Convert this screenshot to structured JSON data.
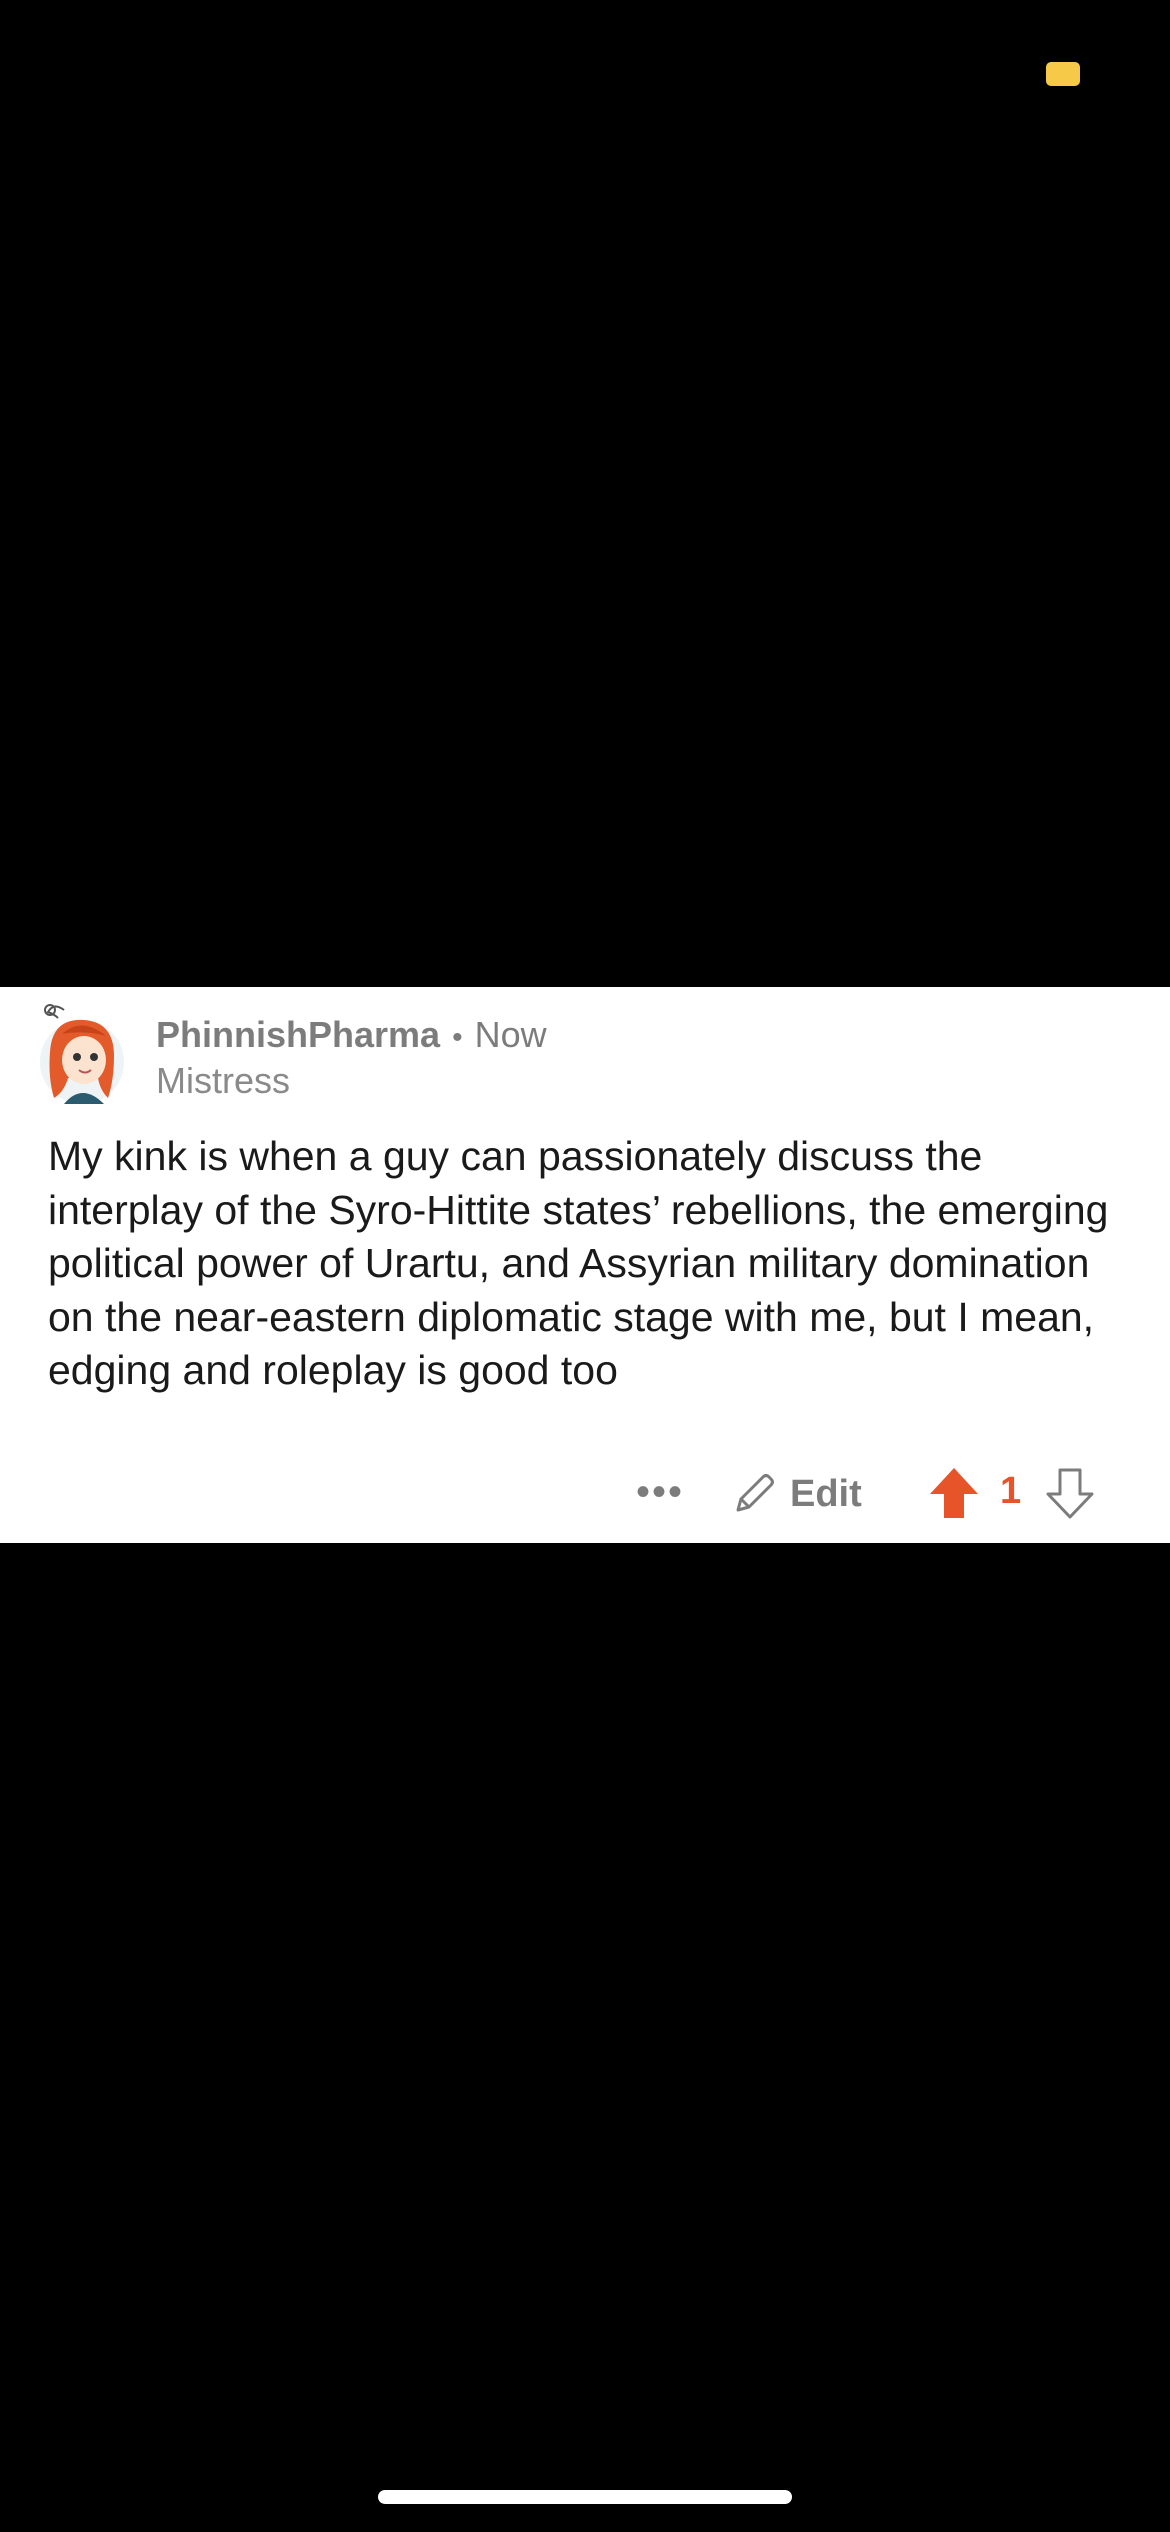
{
  "comment": {
    "username": "PhinnishPharma",
    "separator": "•",
    "time": "Now",
    "flair": "Mistress",
    "body": "My kink is when a guy can passionately discuss the interplay of the Syro-Hittite states’ rebellions, the emerging political power of Urartu, and Assyrian military domination on the near-eastern diplomatic stage with me, but I mean, edging and roleplay is good too"
  },
  "actions": {
    "more_label": "•••",
    "edit_label": "Edit",
    "vote_count": "1"
  },
  "colors": {
    "upvote_active": "#e8542a",
    "status_indicator": "#f7c948",
    "meta_text": "#7c7c7c"
  },
  "icons": {
    "avatar": "redhead-avatar-icon",
    "edit": "pencil-icon",
    "upvote": "arrow-up-icon",
    "downvote": "arrow-down-icon"
  }
}
